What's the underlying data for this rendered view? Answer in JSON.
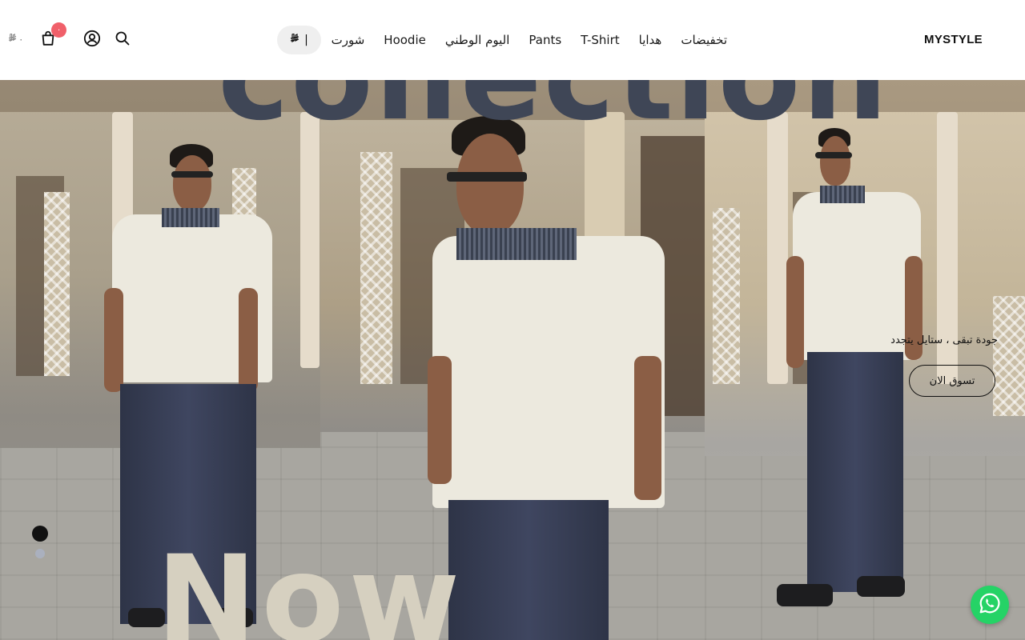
{
  "header": {
    "logo": "MYSTYLE",
    "nav": [
      {
        "label": "تخفيضات"
      },
      {
        "label": "هدايا"
      },
      {
        "label": "T-Shirt"
      },
      {
        "label": "Pants"
      },
      {
        "label": "اليوم الوطني"
      },
      {
        "label": "Hoodie"
      },
      {
        "label": "شورت"
      }
    ],
    "currency_label": "|",
    "cart": {
      "total": "٠",
      "count": "٠"
    },
    "icons": {
      "currency": "riyal-icon",
      "cart": "shopping-bag-icon",
      "account": "user-icon",
      "search": "search-icon"
    }
  },
  "hero": {
    "word_top": "collection",
    "word_bottom": "Now",
    "tagline": "جودة تبقى ، ستايل يتجدد",
    "cta": "تسوق الان",
    "slides_count": 2,
    "active_slide": 1
  },
  "colors": {
    "accent_badge": "#f0606a",
    "whatsapp": "#25d366",
    "headline_dark": "#3f4656",
    "headline_light": "#d6d0c0"
  }
}
